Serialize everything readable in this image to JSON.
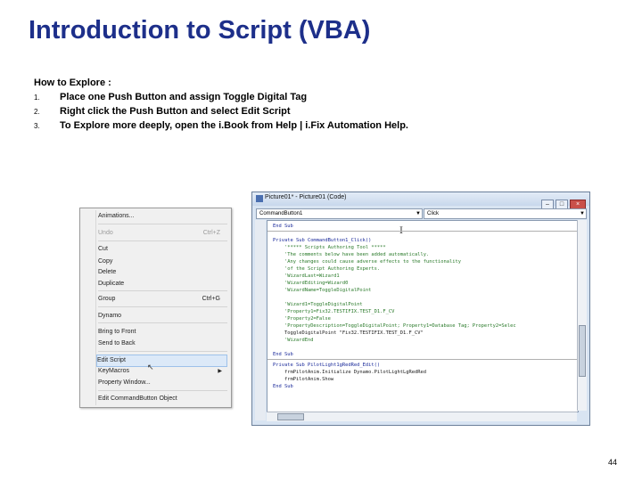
{
  "slide": {
    "title": "Introduction to Script (VBA)",
    "intro": "How to Explore :",
    "steps": [
      {
        "num": "1.",
        "text": "Place one Push Button and assign Toggle Digital Tag"
      },
      {
        "num": "2.",
        "text": "Right click the Push Button and select Edit Script"
      },
      {
        "num": "3.",
        "text": "To Explore more deeply, open the i.Book from Help | i.Fix Automation Help."
      }
    ],
    "page_number": "44"
  },
  "context_menu": {
    "items": [
      {
        "label": "Animations...",
        "shortcut": "",
        "disabled": false
      },
      {
        "label": "Undo",
        "shortcut": "Ctrl+Z",
        "disabled": true
      },
      {
        "label": "Cut",
        "shortcut": "",
        "disabled": false
      },
      {
        "label": "Copy",
        "shortcut": "",
        "disabled": false
      },
      {
        "label": "Delete",
        "shortcut": "",
        "disabled": false
      },
      {
        "label": "Duplicate",
        "shortcut": "",
        "disabled": false
      },
      {
        "label": "Group",
        "shortcut": "Ctrl+G",
        "disabled": false
      },
      {
        "label": "Dynamo",
        "shortcut": "",
        "disabled": false
      },
      {
        "label": "Bring to Front",
        "shortcut": "",
        "disabled": false
      },
      {
        "label": "Send to Back",
        "shortcut": "",
        "disabled": false
      },
      {
        "label": "Edit Script",
        "shortcut": "",
        "disabled": false,
        "highlighted": true
      },
      {
        "label": "KeyMacros",
        "shortcut": "",
        "disabled": false,
        "submenu": true
      },
      {
        "label": "Property Window...",
        "shortcut": "",
        "disabled": false
      },
      {
        "label": "Edit CommandButton Object",
        "shortcut": "",
        "disabled": false
      }
    ]
  },
  "code_window": {
    "title": "Picture01* - Picture01 (Code)",
    "object_combo": "CommandButton1",
    "procedure_combo": "Click",
    "lines": [
      {
        "text": "End Sub",
        "kind": "kw"
      },
      {
        "text": "Private Sub CommandButton1_Click()",
        "kind": "kw"
      },
      {
        "text": "    '***** Scripts Authoring Tool *****",
        "kind": "comment"
      },
      {
        "text": "    'The comments below have been added automatically.",
        "kind": "comment"
      },
      {
        "text": "    'Any changes could cause adverse effects to the functionality",
        "kind": "comment"
      },
      {
        "text": "    'of the Script Authoring Experts.",
        "kind": "comment"
      },
      {
        "text": "    'WizardLast=Wizard1",
        "kind": "comment"
      },
      {
        "text": "    'WizardEditing=Wizard0",
        "kind": "comment"
      },
      {
        "text": "    'WizardName=ToggleDigitalPoint",
        "kind": "comment"
      },
      {
        "text": "",
        "kind": "plain"
      },
      {
        "text": "    'Wizard1=ToggleDigitalPoint",
        "kind": "comment"
      },
      {
        "text": "    'Property1=Fix32.TESTIFIX.TEST_D1.F_CV",
        "kind": "comment"
      },
      {
        "text": "    'Property2=False",
        "kind": "comment"
      },
      {
        "text": "    'PropertyDescription=ToggleDigitalPoint; Property1=Database Tag; Property2=Selec",
        "kind": "comment"
      },
      {
        "text": "    ToggleDigitalPoint \"Fix32.TESTIFIX.TEST_D1.F_CV\"",
        "kind": "plain"
      },
      {
        "text": "    'WizardEnd",
        "kind": "comment"
      },
      {
        "text": "",
        "kind": "plain"
      },
      {
        "text": "End Sub",
        "kind": "kw"
      },
      {
        "text": "Private Sub PilotLight1gRedRed_Edit()",
        "kind": "kw"
      },
      {
        "text": "    frmPilotAnim.Initialize Dynamo.PilotLightLgRedRed",
        "kind": "plain"
      },
      {
        "text": "    frmPilotAnim.Show",
        "kind": "plain"
      },
      {
        "text": "End Sub",
        "kind": "kw"
      }
    ]
  }
}
